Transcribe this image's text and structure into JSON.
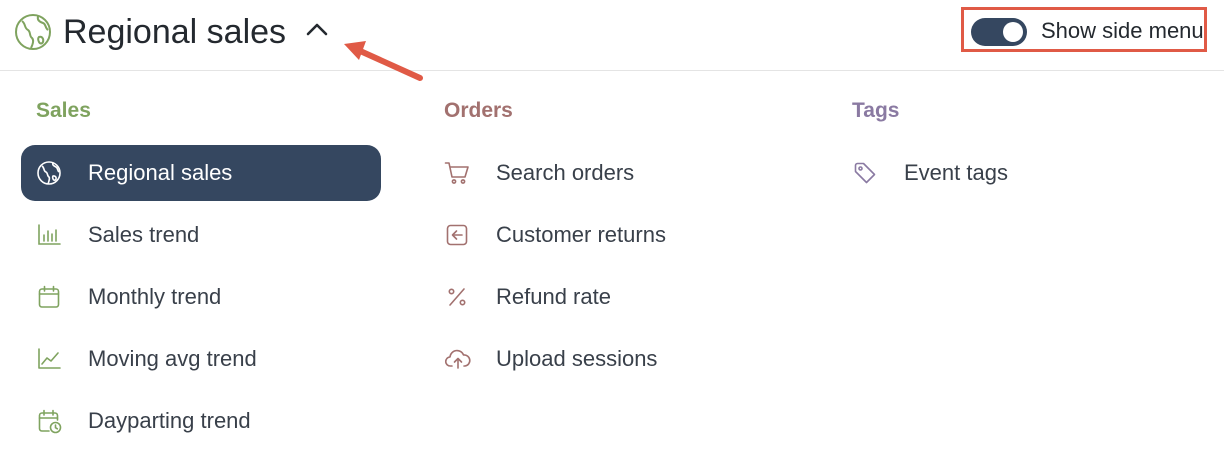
{
  "header": {
    "title": "Regional sales",
    "title_icon": "globe-icon",
    "caret_icon": "chevron-up-icon",
    "toggle": {
      "label": "Show side menu",
      "on": true
    }
  },
  "sections": {
    "sales": {
      "title": "Sales",
      "color": "#7fa35f",
      "items": [
        {
          "label": "Regional sales",
          "icon": "globe-icon",
          "active": true
        },
        {
          "label": "Sales trend",
          "icon": "bar-chart-icon"
        },
        {
          "label": "Monthly trend",
          "icon": "calendar-icon"
        },
        {
          "label": "Moving avg trend",
          "icon": "line-chart-icon"
        },
        {
          "label": "Dayparting trend",
          "icon": "calendar-clock-icon"
        }
      ]
    },
    "orders": {
      "title": "Orders",
      "color": "#a2716f",
      "items": [
        {
          "label": "Search orders",
          "icon": "cart-icon"
        },
        {
          "label": "Customer returns",
          "icon": "return-icon"
        },
        {
          "label": "Refund rate",
          "icon": "percent-icon"
        },
        {
          "label": "Upload sessions",
          "icon": "cloud-upload-icon"
        }
      ]
    },
    "tags": {
      "title": "Tags",
      "color": "#8a7aa2",
      "items": [
        {
          "label": "Event tags",
          "icon": "tag-icon"
        }
      ]
    }
  },
  "colors": {
    "active_bg": "#354760",
    "annotation": "#e05a46"
  }
}
